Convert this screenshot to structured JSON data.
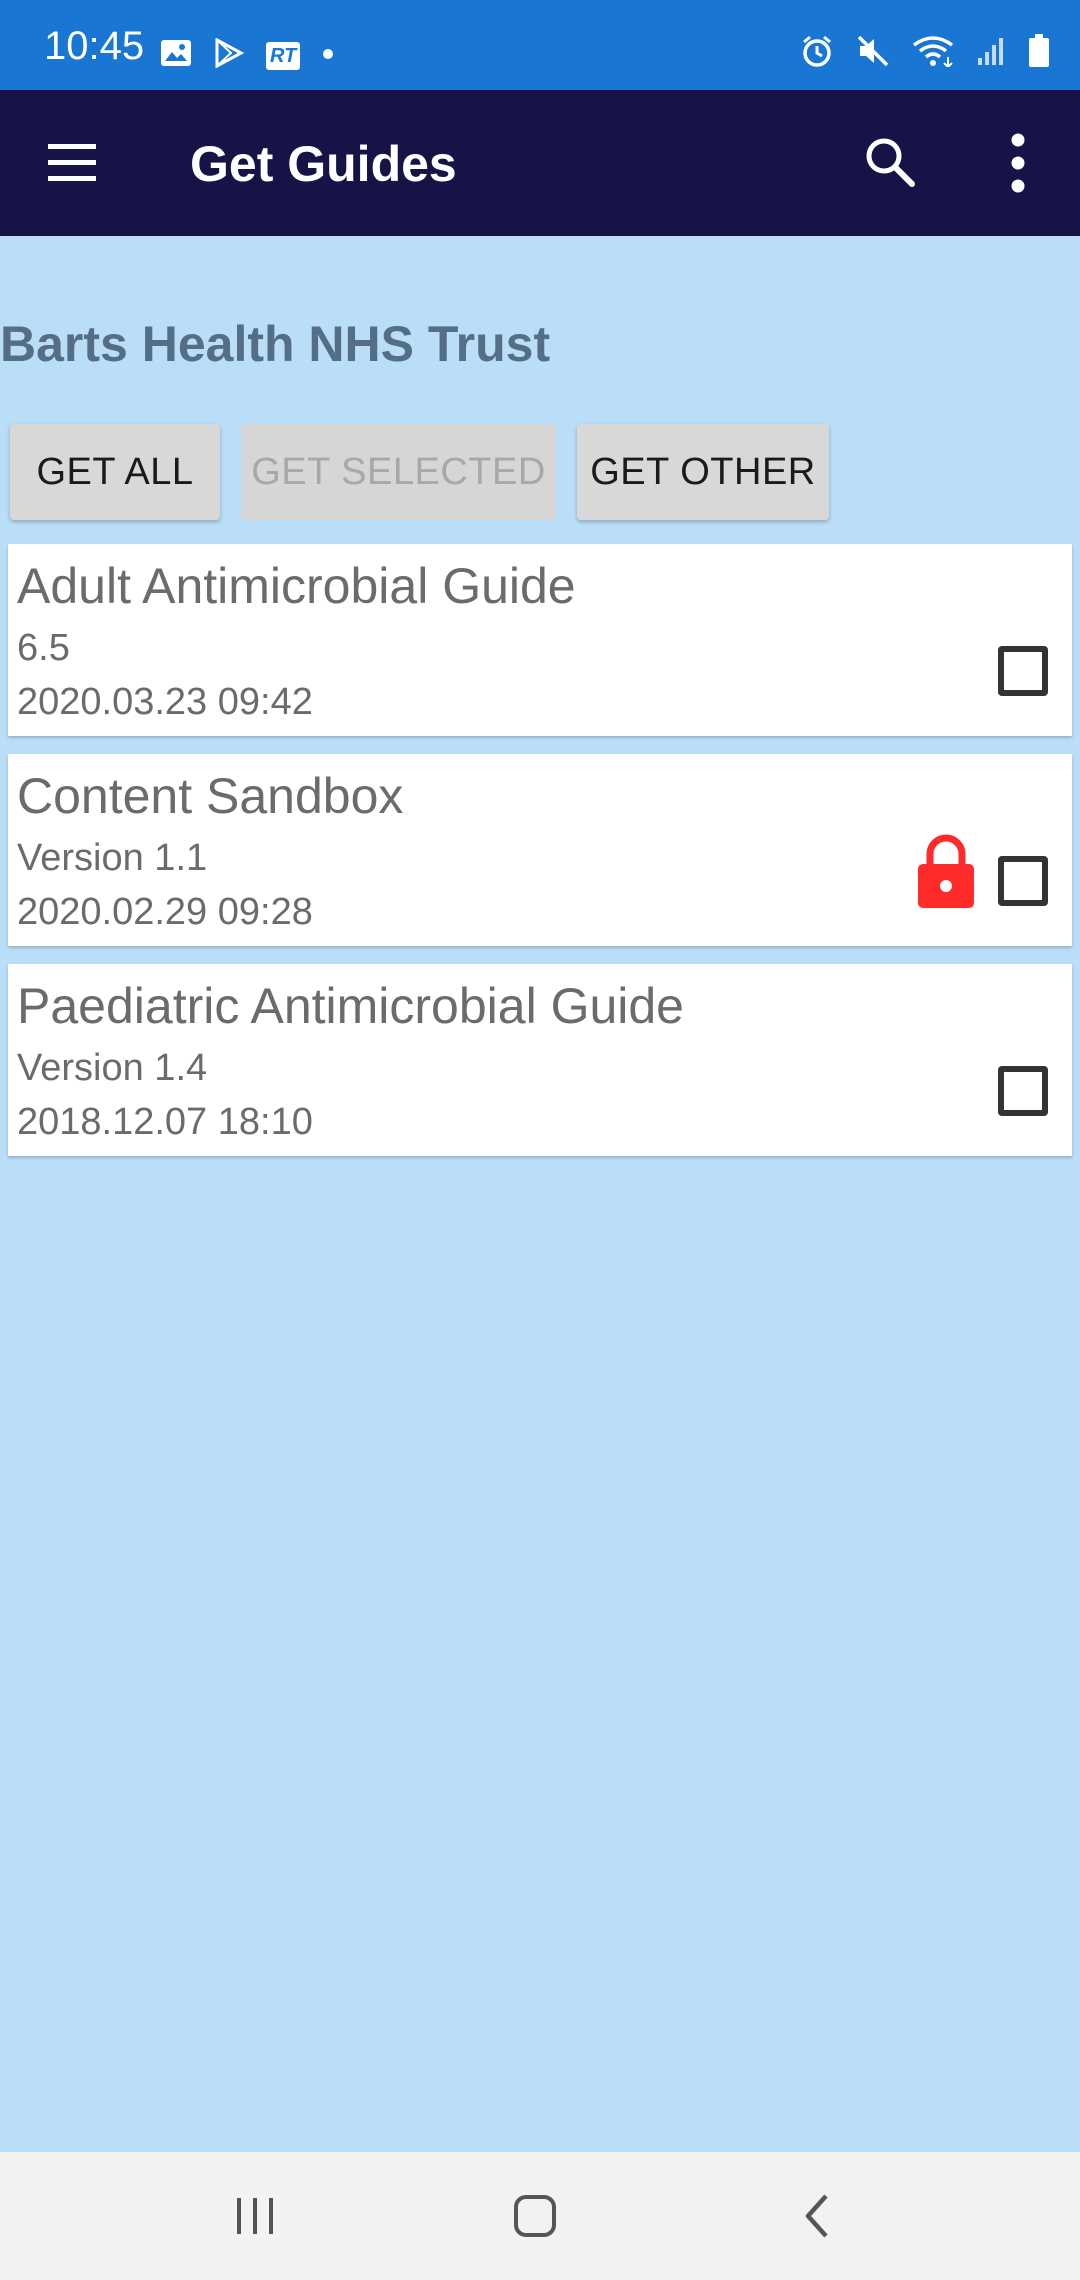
{
  "status_bar": {
    "time": "10:45",
    "left_icons": [
      "image-icon",
      "play-store-icon",
      "rt-news-icon",
      "dot-icon"
    ],
    "rt_label": "RT",
    "right_icons": [
      "alarm-icon",
      "mute-icon",
      "wifi-icon",
      "signal-icon",
      "battery-icon"
    ]
  },
  "app_bar": {
    "title": "Get Guides",
    "icons": [
      "menu-icon",
      "search-icon",
      "more-vert-icon"
    ]
  },
  "organization": {
    "name": "Barts Health NHS Trust"
  },
  "actions": {
    "get_all": "GET ALL",
    "get_selected": "GET SELECTED",
    "get_other": "GET OTHER"
  },
  "guides": [
    {
      "name": "Adult Antimicrobial Guide",
      "version": "6.5",
      "date": "2020.03.23 09:42",
      "locked": false,
      "checked": false
    },
    {
      "name": "Content Sandbox",
      "version": "Version 1.1",
      "date": "2020.02.29 09:28",
      "locked": true,
      "checked": false
    },
    {
      "name": "Paediatric Antimicrobial Guide",
      "version": "Version 1.4",
      "date": "2018.12.07 18:10",
      "locked": false,
      "checked": false
    }
  ],
  "colors": {
    "status_bar": "#1976d2",
    "app_bar": "#161447",
    "background": "#bbdef8",
    "lock": "#ff2a2a",
    "org_title": "#546e86"
  },
  "nav_bar": {
    "icons": [
      "recents-icon",
      "home-icon",
      "back-icon"
    ]
  }
}
